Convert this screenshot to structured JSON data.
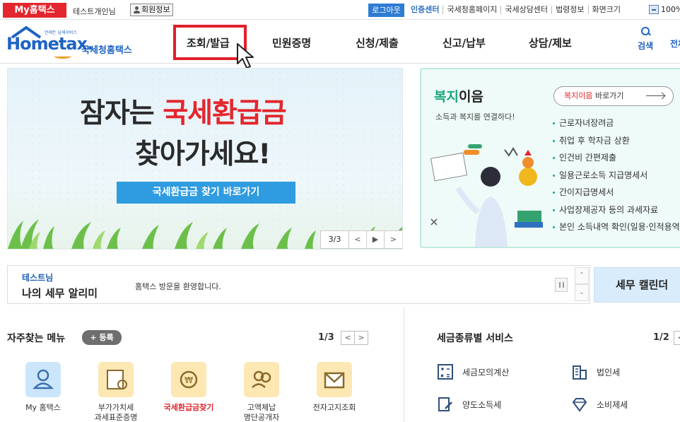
{
  "topbar": {
    "my_hometax": "My홈택스",
    "user_name": "테스트개인님",
    "member_info": "회원정보",
    "logout": "로그아웃",
    "links": [
      "인증센터",
      "국세청홈페이지",
      "국세상담센터",
      "법령정보",
      "화면크기"
    ],
    "zoom": "100%"
  },
  "logo": {
    "tagline": "언제든 납세서비스",
    "word_pre": "Hom",
    "word_e": "e",
    "word_post": "tax.",
    "korean": "국세청홈택스"
  },
  "gnb": {
    "items": [
      "조회/발급",
      "민원증명",
      "신청/제출",
      "신고/납부",
      "상담/제보"
    ],
    "search": "검색",
    "full_menu": "전체메뉴"
  },
  "hero": {
    "line1_pre": "잠자는 ",
    "line1_red": "국세환급금",
    "line2": "찾아가세요!",
    "button": "국세환급금 찾기 바로가기",
    "pager": "3/3",
    "prev": "<",
    "play": "▶",
    "next": ">"
  },
  "welfare": {
    "title_green": "복지",
    "title_rest": "이음",
    "subtitle": "소득과 복지를 연결하다!",
    "goto_hl": "복지이음",
    "goto_rest": " 바로가기",
    "items": [
      "근로자녀장려금",
      "취업 후 학자금 상환",
      "인건비 간편제출",
      "일용근로소득 지급명세서",
      "간이지급명세서",
      "사업장제공자 등의 과세자료",
      "본인 소득내역 확인(일용·인적용역)"
    ]
  },
  "notice": {
    "who": "테스트님",
    "title": "나의 세무 알리미",
    "message": "홈택스 방문을 환영합니다.",
    "up": "⌃",
    "down": "⌄"
  },
  "calendar": "세무 캘린더",
  "favorites": {
    "title": "자주찾는 메뉴",
    "register": "+ 등록",
    "page": "1/3",
    "items": [
      {
        "label": "My 홈택스",
        "label2": ""
      },
      {
        "label": "부가가치세",
        "label2": "과세표준증명"
      },
      {
        "label": "국세환급금찾기",
        "label2": ""
      },
      {
        "label": "고액체납",
        "label2": "명단공개자"
      },
      {
        "label": "전자고지조회",
        "label2": ""
      }
    ]
  },
  "services": {
    "title": "세금종류별 서비스",
    "page": "1/2",
    "items": [
      "세금모의계산",
      "법인세",
      "양도소득세",
      "소비제세"
    ]
  },
  "arrows": {
    "left": "<",
    "right": ">"
  }
}
